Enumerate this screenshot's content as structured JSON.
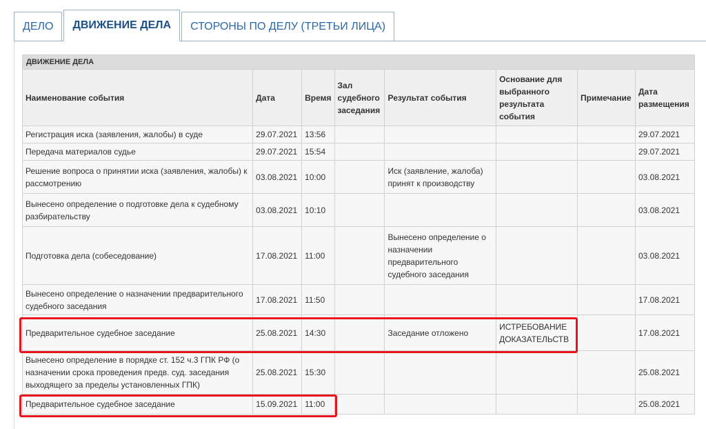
{
  "tabs": [
    {
      "label": "ДЕЛО",
      "active": false
    },
    {
      "label": "ДВИЖЕНИЕ ДЕЛА",
      "active": true
    },
    {
      "label": "СТОРОНЫ ПО ДЕЛУ (ТРЕТЬИ ЛИЦА)",
      "active": false
    }
  ],
  "section_title": "ДВИЖЕНИЕ ДЕЛА",
  "columns": [
    "Наименование события",
    "Дата",
    "Время",
    "Зал судебного заседания",
    "Результат события",
    "Основание для выбранного результата события",
    "Примечание",
    "Дата размещения"
  ],
  "rows": [
    [
      "Регистрация иска (заявления, жалобы) в суде",
      "29.07.2021",
      "13:56",
      "",
      "",
      "",
      "",
      "29.07.2021"
    ],
    [
      "Передача материалов судье",
      "29.07.2021",
      "15:54",
      "",
      "",
      "",
      "",
      "29.07.2021"
    ],
    [
      "Решение вопроса о принятии иска (заявления, жалобы) к рассмотрению",
      "03.08.2021",
      "10:00",
      "",
      "Иск (заявление, жалоба) принят к производству",
      "",
      "",
      "03.08.2021"
    ],
    [
      "Вынесено определение о подготовке дела к судебному разбирательству",
      "03.08.2021",
      "10:10",
      "",
      "",
      "",
      "",
      "03.08.2021"
    ],
    [
      "Подготовка дела (собеседование)",
      "17.08.2021",
      "11:00",
      "",
      "Вынесено определение о назначении предварительного судебного заседания",
      "",
      "",
      "03.08.2021"
    ],
    [
      "Вынесено определение о назначении предварительного судебного заседания",
      "17.08.2021",
      "11:50",
      "",
      "",
      "",
      "",
      "17.08.2021"
    ],
    [
      "Предварительное судебное заседание",
      "25.08.2021",
      "14:30",
      "",
      "Заседание отложено",
      "ИСТРЕБОВАНИЕ ДОКАЗАТЕЛЬСТВ",
      "",
      "17.08.2021"
    ],
    [
      "Вынесено определение в порядке ст. 152 ч.3 ГПК РФ (о назначении срока проведения предв. суд. заседания выходящего за пределы установленных ГПК)",
      "25.08.2021",
      "15:30",
      "",
      "",
      "",
      "",
      "25.08.2021"
    ],
    [
      "Предварительное судебное заседание",
      "15.09.2021",
      "11:00",
      "",
      "",
      "",
      "",
      "25.08.2021"
    ]
  ]
}
